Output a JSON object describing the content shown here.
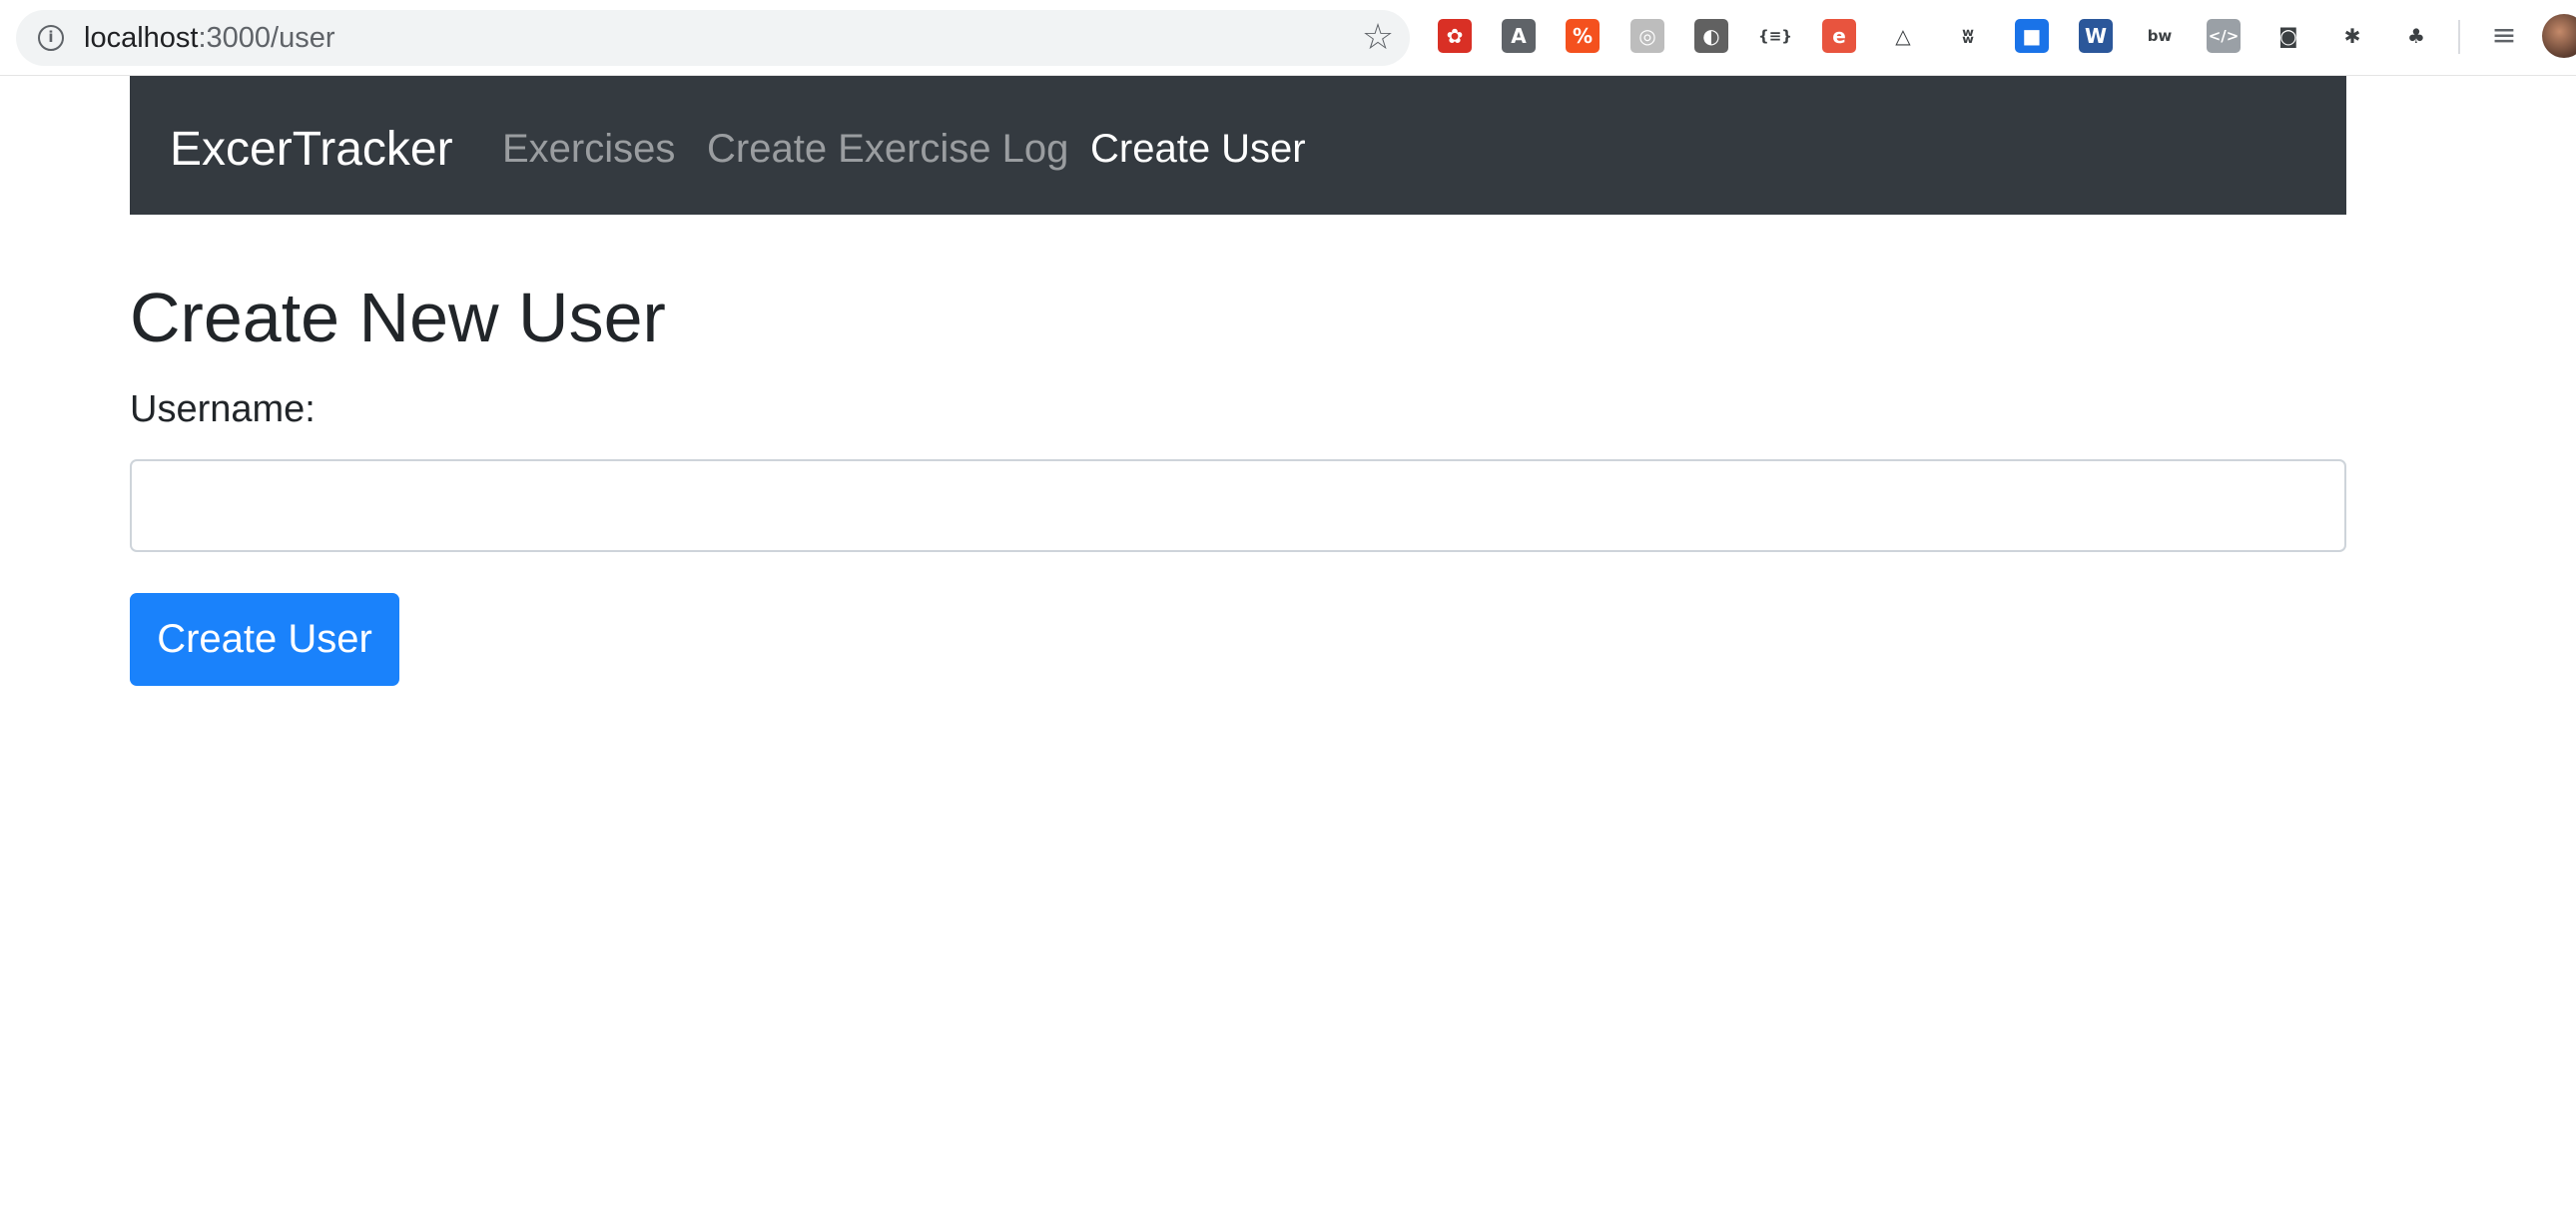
{
  "browser": {
    "url_host": "localhost",
    "url_path": ":3000/user",
    "extensions": [
      {
        "name": "ext-red-icon",
        "glyph": "✿",
        "color": "#d93025"
      },
      {
        "name": "ext-a-icon",
        "glyph": "A",
        "color": "#5f6368"
      },
      {
        "name": "ext-percent-icon",
        "glyph": "%",
        "color": "#f4511e"
      },
      {
        "name": "ext-target-icon",
        "glyph": "◎",
        "color": "#bdbdbd"
      },
      {
        "name": "ext-circle-icon",
        "glyph": "◐",
        "color": "#616161"
      },
      {
        "name": "ext-json-icon",
        "glyph": "{≡}",
        "color": "#ffffff"
      },
      {
        "name": "ext-e-icon",
        "glyph": "e",
        "color": "#e8543e"
      },
      {
        "name": "ext-triangle-icon",
        "glyph": "△",
        "color": "#ffffff"
      },
      {
        "name": "ext-wb-icon",
        "glyph": "ʬ",
        "color": "#ffffff"
      },
      {
        "name": "ext-bookmark-icon",
        "glyph": "■",
        "color": "#1a73e8"
      },
      {
        "name": "ext-word-icon",
        "glyph": "W",
        "color": "#2b579a"
      },
      {
        "name": "ext-bw-icon",
        "glyph": "bw",
        "color": "#ffffff"
      },
      {
        "name": "ext-code-icon",
        "glyph": "</>",
        "color": "#9aa0a6"
      },
      {
        "name": "ext-camera-icon",
        "glyph": "◙",
        "color": "#ffffff"
      },
      {
        "name": "ext-bug-icon",
        "glyph": "✱",
        "color": "#ffffff"
      },
      {
        "name": "ext-html-tree-icon",
        "glyph": "♣",
        "color": "#ffffff"
      }
    ]
  },
  "navbar": {
    "brand": "ExcerTracker",
    "links": [
      {
        "label": "Exercises",
        "active": false
      },
      {
        "label": "Create Exercise Log",
        "active": false
      },
      {
        "label": "Create User",
        "active": true
      }
    ]
  },
  "form": {
    "title": "Create New User",
    "username_label": "Username:",
    "username_value": "",
    "submit_label": "Create User"
  },
  "colors": {
    "navbar_bg": "#343a40",
    "primary": "#1a82fb"
  }
}
